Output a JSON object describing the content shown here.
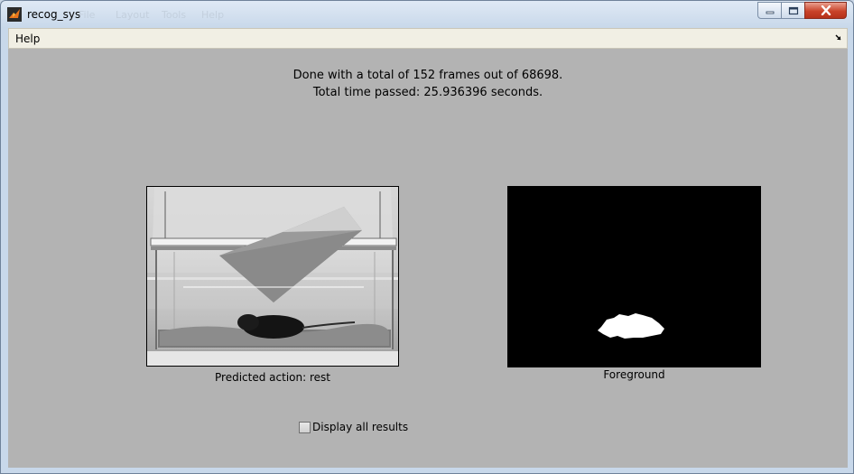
{
  "window": {
    "title": "recog_sys",
    "icon": "matlab-icon",
    "ghost_menus": [
      "File",
      "Layout",
      "Tools",
      "Help"
    ]
  },
  "menubar": {
    "items": [
      "Help"
    ]
  },
  "status": {
    "line1": "Done with a total of 152 frames out of 68698.",
    "line2": "Total time passed: 25.936396 seconds."
  },
  "panels": {
    "video_frame_caption": "Predicted action: rest",
    "foreground_caption": "Foreground"
  },
  "checkbox": {
    "label": "Display all results",
    "checked": false
  },
  "colors": {
    "figure_background": "#b3b3b3",
    "menubar_background": "#f1efe4",
    "close_button": "#c9432a"
  }
}
